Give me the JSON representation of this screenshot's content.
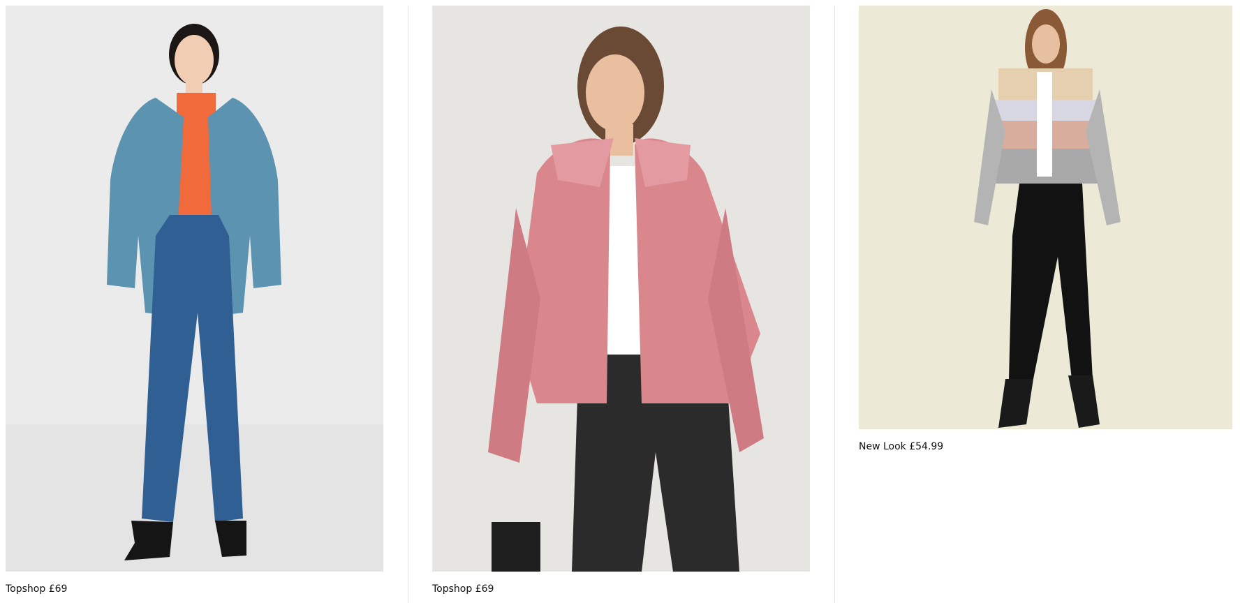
{
  "products": [
    {
      "caption": "Topshop £69",
      "image_alt": "Blue teddy faux fur coat",
      "colors": {
        "background": "#ececec",
        "coat": "#5b93b0",
        "top": "#f06a3c",
        "jeans": "#2f5f93"
      }
    },
    {
      "caption": "Topshop £69",
      "image_alt": "Pink faux fur jacket",
      "colors": {
        "background": "#e6e5e1",
        "coat": "#d9868d",
        "top": "#ffffff",
        "jeans": "#2b2b2b"
      }
    },
    {
      "caption": "New Look £54.99",
      "image_alt": "Multicolour stripe faux fur jacket",
      "colors": {
        "background": "#ecead7",
        "coat": "#bdb5ae",
        "top": "#ffffff",
        "jeans": "#121212"
      }
    }
  ]
}
